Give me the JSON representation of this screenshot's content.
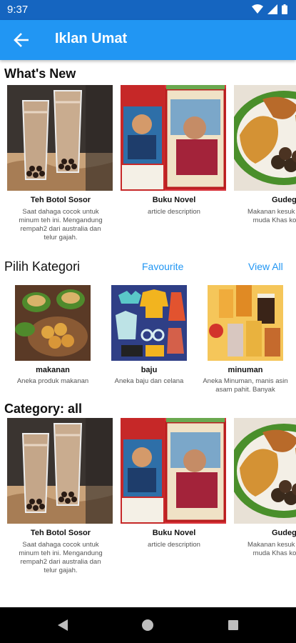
{
  "status": {
    "time": "9:37"
  },
  "appbar": {
    "title": "Iklan Umat"
  },
  "whats_new": {
    "title": "What's New",
    "items": [
      {
        "name": "Teh Botol Sosor",
        "desc": "Saat dahaga cocok untuk minum teh ini. Mengandung rempah2 dari australia dan telur gajah."
      },
      {
        "name": "Buku Novel",
        "desc": "article description"
      },
      {
        "name": "Gudeg J",
        "desc": "Makanan kesuk orang, tua muda Khas kota pelaja"
      }
    ]
  },
  "kategori": {
    "title": "Pilih Kategori",
    "favourite_label": "Favourite",
    "view_all_label": "View All",
    "items": [
      {
        "name": "makanan",
        "desc": "Aneka produk makanan"
      },
      {
        "name": "baju",
        "desc": "Aneka baju dan celana"
      },
      {
        "name": "minuman",
        "desc": "Aneka Minuman, manis asin asam pahit. Banyak"
      }
    ]
  },
  "category_all": {
    "title": "Category: all",
    "items": [
      {
        "name": "Teh Botol Sosor",
        "desc": "Saat dahaga cocok untuk minum teh ini. Mengandung rempah2 dari australia dan telur gajah."
      },
      {
        "name": "Buku Novel",
        "desc": "article description"
      },
      {
        "name": "Gudeg J",
        "desc": "Makanan kesuk orang, tua muda Khas kota pelaja"
      }
    ]
  },
  "colors": {
    "primary": "#2196f3",
    "status_bar": "#1565c0",
    "nav_bar": "#000000"
  }
}
